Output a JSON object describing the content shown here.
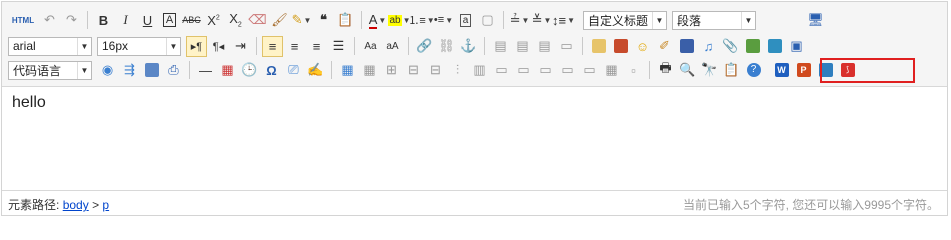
{
  "toolbar": {
    "html_label": "HTML",
    "font_family": "arial",
    "font_size": "16px",
    "custom_heading": "自定义标题",
    "paragraph_format": "段落",
    "code_language": "代码语言"
  },
  "editor": {
    "content_text": "hello"
  },
  "status": {
    "path_label": "元素路径:",
    "path_body": "body",
    "path_sep": ">",
    "path_p": "p",
    "word_count": "当前已输入5个字符, 您还可以输入9995个字符。"
  },
  "colors": {
    "highlight_border": "#e02020",
    "word_icon": "#1f5fbf",
    "pdf_icon": "#d9302c",
    "ppt_icon": "#d04a1e",
    "link": "#0044cc"
  }
}
